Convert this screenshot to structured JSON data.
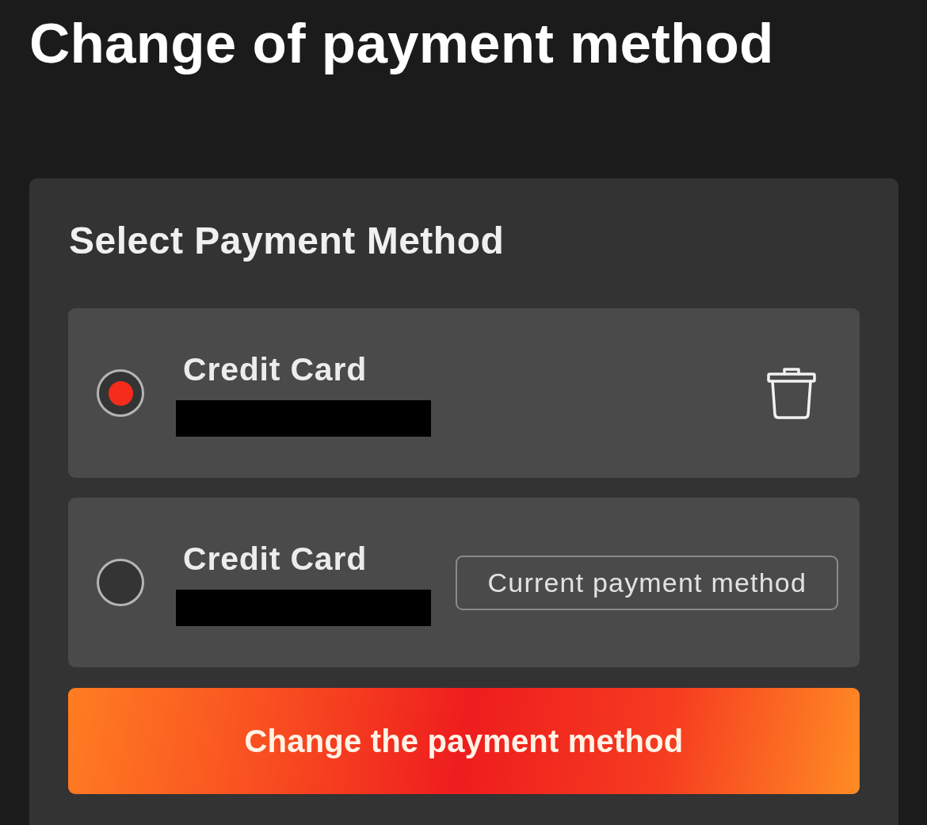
{
  "page": {
    "title": "Change of payment method"
  },
  "panel": {
    "heading": "Select Payment Method",
    "methods": [
      {
        "name": "Credit Card",
        "number_redacted": true,
        "selected": true,
        "deletable": true
      },
      {
        "name": "Credit Card",
        "number_redacted": true,
        "selected": false,
        "deletable": false,
        "badge": "Current payment method"
      }
    ],
    "submit_button": "Change the payment method"
  }
}
